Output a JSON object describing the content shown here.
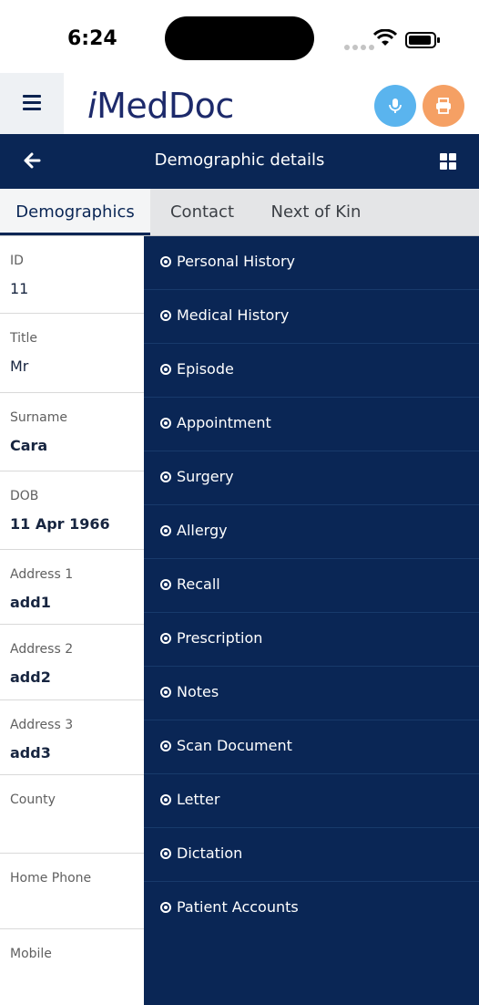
{
  "status_bar": {
    "time": "6:24"
  },
  "header": {
    "logo_text": "MedDoc",
    "logo_prefix": "i"
  },
  "title_bar": {
    "title": "Demographic details"
  },
  "tabs": [
    {
      "label": "Demographics",
      "active": true
    },
    {
      "label": "Contact",
      "active": false
    },
    {
      "label": "Next of Kin",
      "active": false
    }
  ],
  "fields": [
    {
      "label": "ID",
      "value": "11"
    },
    {
      "label": "Title",
      "value": "Mr"
    },
    {
      "label": "Surname",
      "value": "Cara"
    },
    {
      "label": "DOB",
      "value": "11 Apr 1966"
    },
    {
      "label": "Address 1",
      "value": "add1"
    },
    {
      "label": "Address 2",
      "value": "add2"
    },
    {
      "label": "Address 3",
      "value": "add3"
    },
    {
      "label": "County",
      "value": ""
    },
    {
      "label": "Home Phone",
      "value": ""
    },
    {
      "label": "Mobile",
      "value": ""
    }
  ],
  "side_menu": [
    "Personal History",
    "Medical History",
    "Episode",
    "Appointment",
    "Surgery",
    "Allergy",
    "Recall",
    "Prescription",
    "Notes",
    "Scan Document",
    "Letter",
    "Dictation",
    "Patient Accounts"
  ],
  "colors": {
    "navy": "#0a2655",
    "mic_button": "#5ab4ee",
    "print_button": "#f5a064"
  },
  "icons": {
    "menu": "hamburger-icon",
    "mic": "microphone-icon",
    "print": "printer-icon",
    "back": "arrow-left-icon",
    "grid": "grid-icon",
    "menu_bullet": "radio-dot-icon"
  }
}
